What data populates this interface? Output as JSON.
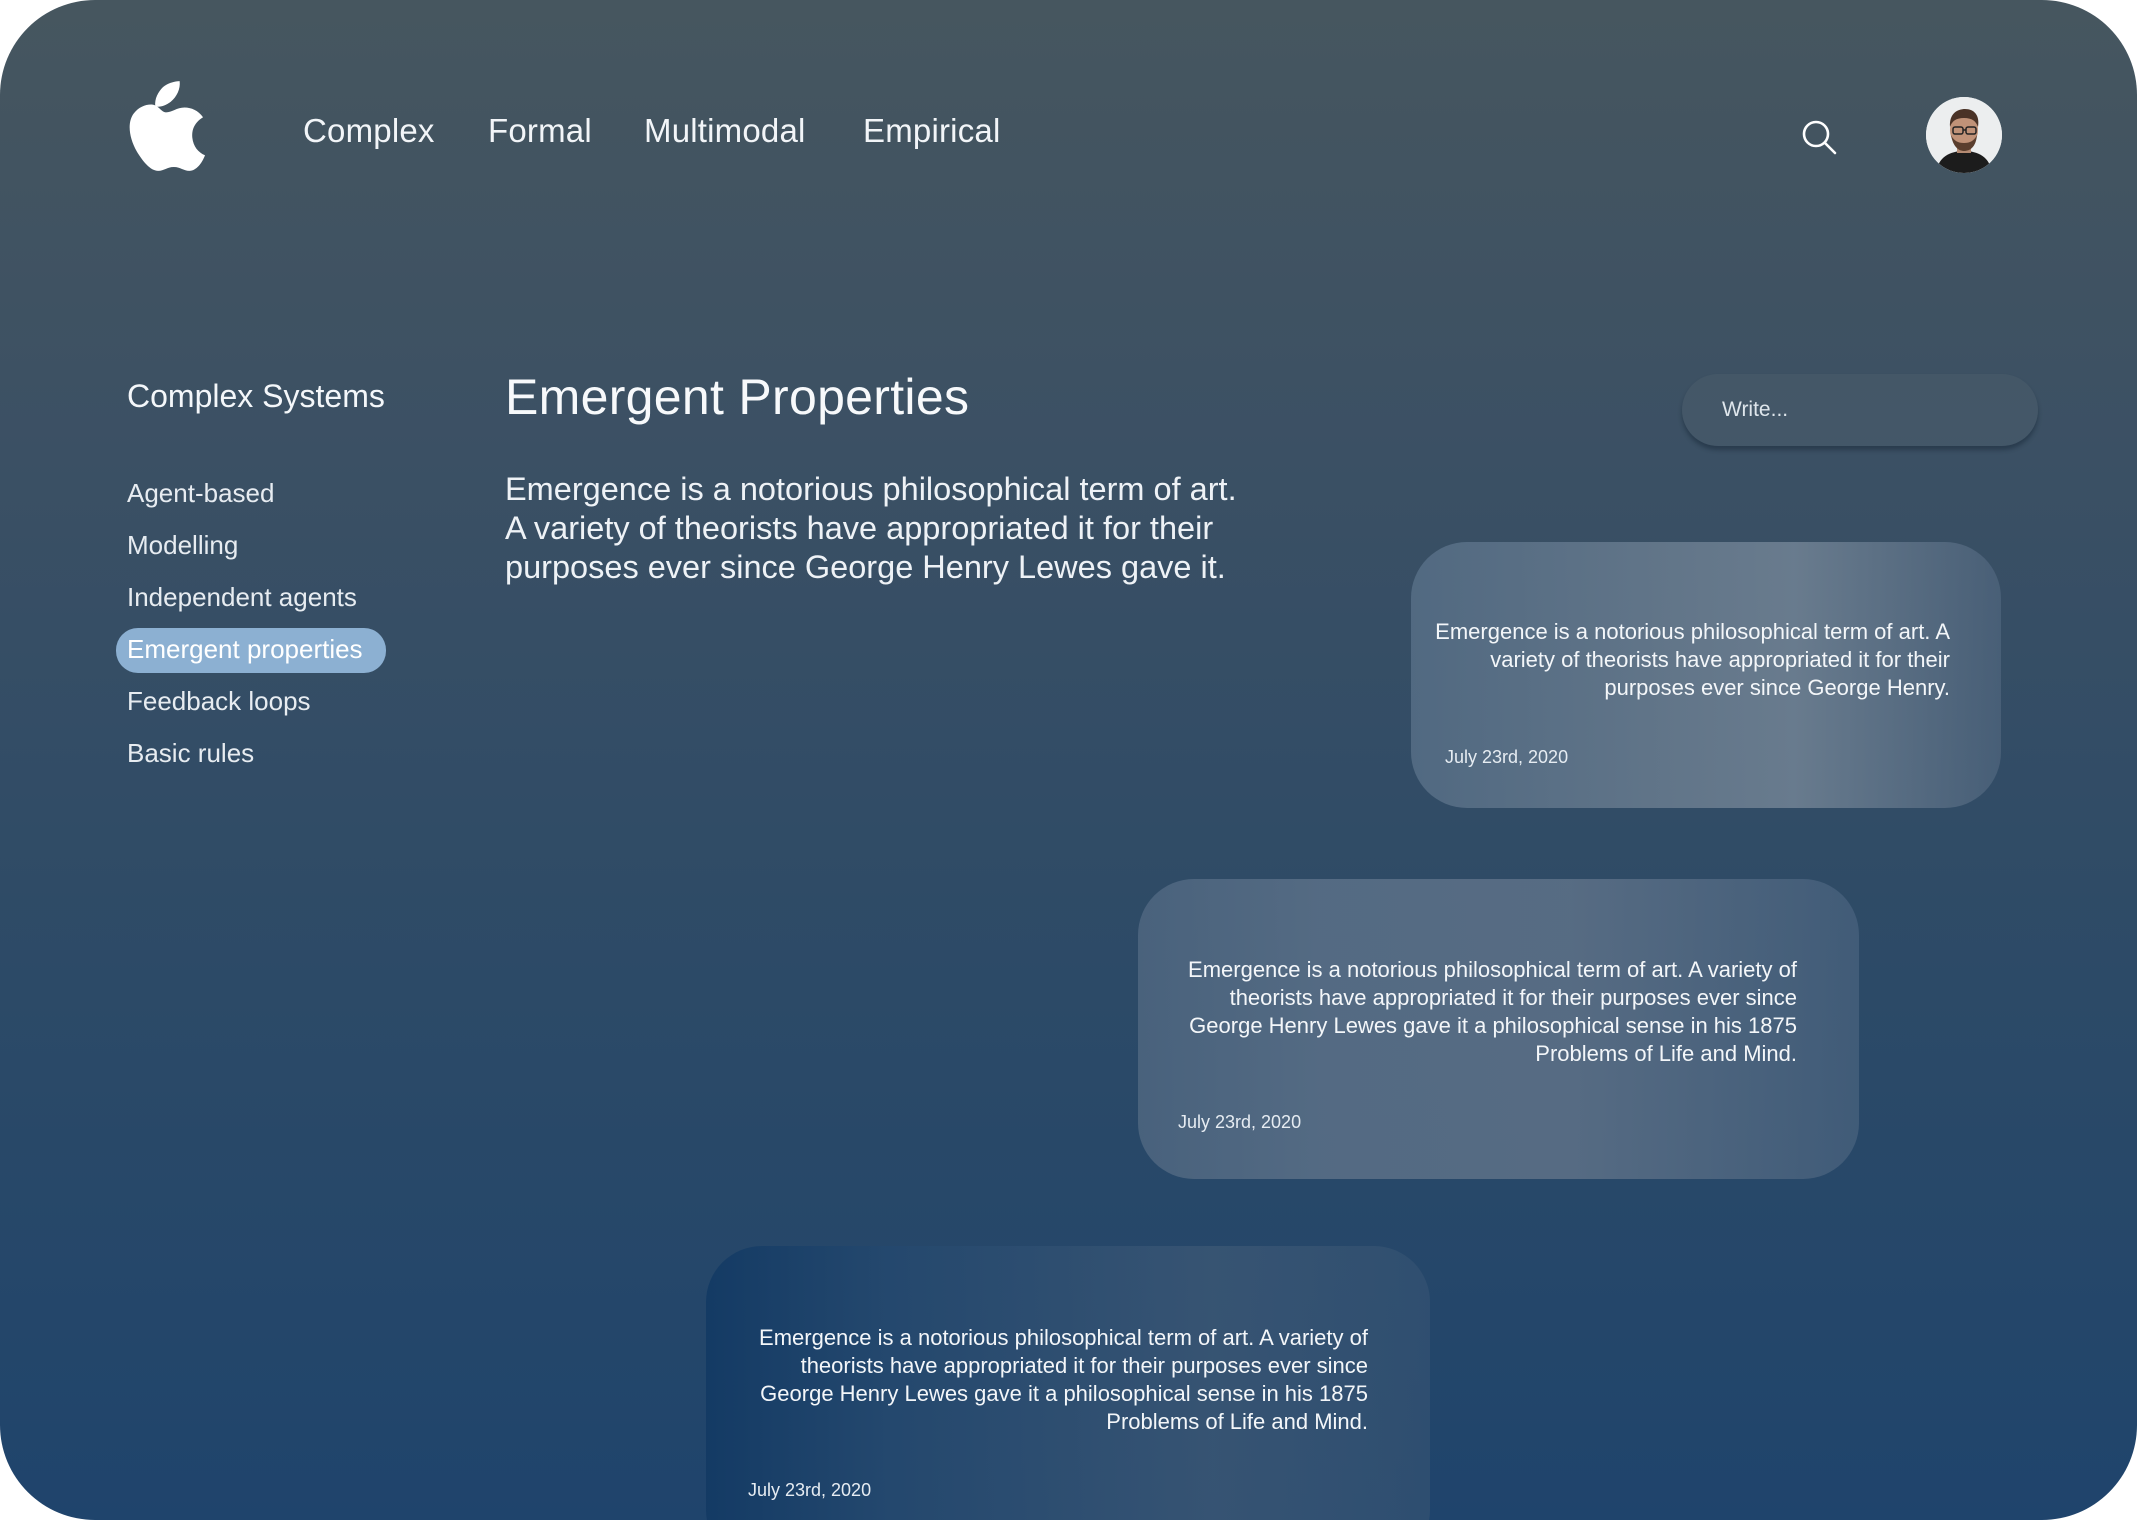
{
  "header": {
    "logo_icon": "apple-logo-icon",
    "nav": [
      "Complex",
      "Formal",
      "Multimodal",
      "Empirical"
    ],
    "search_icon": "search-icon",
    "avatar_icon": "user-avatar"
  },
  "sidebar": {
    "title": "Complex Systems",
    "items": [
      {
        "label": "Agent-based",
        "active": false
      },
      {
        "label": "Modelling",
        "active": false
      },
      {
        "label": "Independent agents",
        "active": false
      },
      {
        "label": "Emergent properties",
        "active": true
      },
      {
        "label": "Feedback loops",
        "active": false
      },
      {
        "label": "Basic rules",
        "active": false
      }
    ],
    "active_color": "#8cb0d2"
  },
  "main": {
    "title": "Emergent Properties",
    "intro": "Emergence is a notorious philosophical term of art. A variety of theorists have appropriated it for their purposes ever since George Henry Lewes gave it."
  },
  "composer": {
    "placeholder": "Write..."
  },
  "cards": [
    {
      "text": "Emergence is a notorious philosophical term of art. A variety of theorists have appropriated it for their purposes ever since George Henry.",
      "date": "July 23rd, 2020"
    },
    {
      "text": "Emergence is a notorious philosophical term of art. A variety of theorists have appropriated it for their purposes ever since George Henry Lewes gave it a philosophical sense in his 1875 Problems of Life and Mind.",
      "date": "July 23rd, 2020"
    },
    {
      "text": "Emergence is a notorious philosophical term of art. A variety of theorists have appropriated it for their purposes ever since George Henry Lewes gave it a philosophical sense in his 1875 Problems of Life and Mind.",
      "date": "July 23rd, 2020"
    }
  ]
}
